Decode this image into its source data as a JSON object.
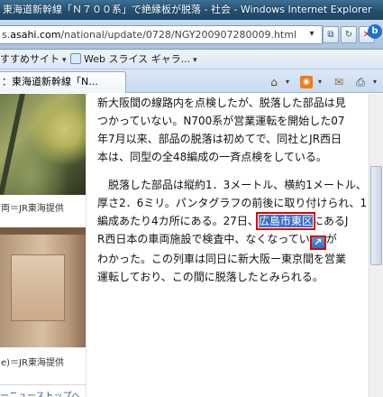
{
  "window": {
    "title": "東海道新幹線「Ｎ７００系」で絶縁板が脱落 - 社会 - Windows Internet Explorer"
  },
  "address_bar": {
    "url_domain": "asahi.com",
    "url_path": "/national/update/0728/NGY200907280009.html",
    "url_prefix": "s."
  },
  "favorites_bar": {
    "items": [
      {
        "label": "すすめサイト"
      },
      {
        "label": "Web スライス ギャラ..."
      }
    ]
  },
  "tab": {
    "label": "：東海道新幹線「N..."
  },
  "left_column": {
    "caption1": "両＝JR東海提供",
    "caption2": "e)＝JR東海提供",
    "news_top_link": "ーニューストップへ"
  },
  "article": {
    "para1_line1": "新大阪間の線路内を点検したが、脱落した部品は見",
    "para1_line2": "つかっていない。N700系が営業運転を開始した07",
    "para1_line3": "年7月以来、部品の脱落は初めてで、同社とJR西日",
    "para1_line4": "本は、同型の全48編成の一斉点検をしている。",
    "para2_line1": "　脱落した部品は縦約1．3メートル、横約1メートル、",
    "para2_line2": "厚さ2．6ミリ。パンタグラフの前後に取り付けられ、1",
    "para2_line3_pre": "編成あたり4カ所にある。27日、",
    "para2_highlight": "広島市東区",
    "para2_line3_post": "にあるJ",
    "para2_line4_pre": "R西日本の車両施設で検査中、なくなってい",
    "para2_line4_post": "が",
    "para2_line5": "わかった。この列車は同日に新大阪ー東京間を営業",
    "para2_line6": "運転しており、この間に脱落したとみられる。"
  },
  "icons": {
    "popup": "open-link-icon"
  }
}
